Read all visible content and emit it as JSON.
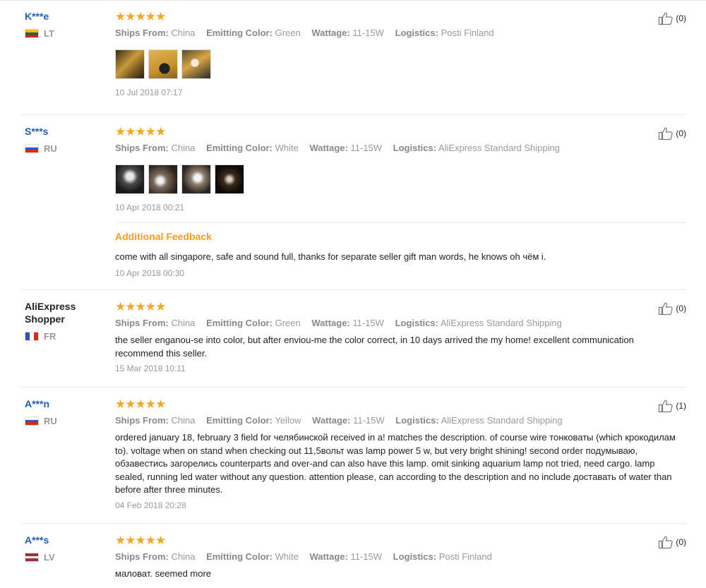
{
  "reviews": [
    {
      "user": "K***e",
      "country": "LT",
      "stars": "★★★★★",
      "ships_label": "Ships From:",
      "ships": "China",
      "color_label": "Emitting Color:",
      "color": "Green",
      "watt_label": "Wattage:",
      "watt": "11-15W",
      "log_label": "Logistics:",
      "log": "Posti Finland",
      "date": "10 Jul 2018 07:17",
      "likes": "(0)"
    },
    {
      "user": "S***s",
      "country": "RU",
      "stars": "★★★★★",
      "ships_label": "Ships From:",
      "ships": "China",
      "color_label": "Emitting Color:",
      "color": "White",
      "watt_label": "Wattage:",
      "watt": "11-15W",
      "log_label": "Logistics:",
      "log": "AliExpress Standard Shipping",
      "date": "10 Apr 2018 00:21",
      "likes": "(0)",
      "additional_title": "Additional Feedback",
      "additional_text": "come with all singapore, safe and sound full, thanks for separate seller gift man words, he knows oh чём i.",
      "additional_date": "10 Apr 2018 00:30"
    },
    {
      "user": "AliExpress Shopper",
      "country": "FR",
      "stars": "★★★★★",
      "ships_label": "Ships From:",
      "ships": "China",
      "color_label": "Emitting Color:",
      "color": "Green",
      "watt_label": "Wattage:",
      "watt": "11-15W",
      "log_label": "Logistics:",
      "log": "AliExpress Standard Shipping",
      "text": "the seller enganou-se into color, but after enviou-me the color correct, in 10 days arrived the my home! excellent communication recommend this seller.",
      "date": "15 Mar 2018 10:11",
      "likes": "(0)"
    },
    {
      "user": "A***n",
      "country": "RU",
      "stars": "★★★★★",
      "ships_label": "Ships From:",
      "ships": "China",
      "color_label": "Emitting Color:",
      "color": "Yellow",
      "watt_label": "Wattage:",
      "watt": "11-15W",
      "log_label": "Logistics:",
      "log": "AliExpress Standard Shipping",
      "text": "ordered january 18, february 3 field for челябинской received in a! matches the description. of course wire тонковаты (which крокодилам to). voltage when on stand when checking out 11,5вольт was lamp power 5 w, but very bright shining! second order подумываю, обзавестись загорелись counterparts and over-and can also have this lamp. omit sinking aquarium lamp not tried, need cargo. lamp sealed, running led water without any question. attention please, can according to the description and no include доставать of water than before after three minutes.",
      "date": "04 Feb 2018 20:28",
      "likes": "(1)"
    },
    {
      "user": "A***s",
      "country": "LV",
      "stars": "★★★★★",
      "ships_label": "Ships From:",
      "ships": "China",
      "color_label": "Emitting Color:",
      "color": "White",
      "watt_label": "Wattage:",
      "watt": "11-15W",
      "log_label": "Logistics:",
      "log": "Posti Finland",
      "text": "маловат. seemed more",
      "likes": "(0)"
    }
  ],
  "colors": {
    "user_link": "#1a5fb4",
    "stars": "#f5a623",
    "additional": "#f39c1f"
  }
}
